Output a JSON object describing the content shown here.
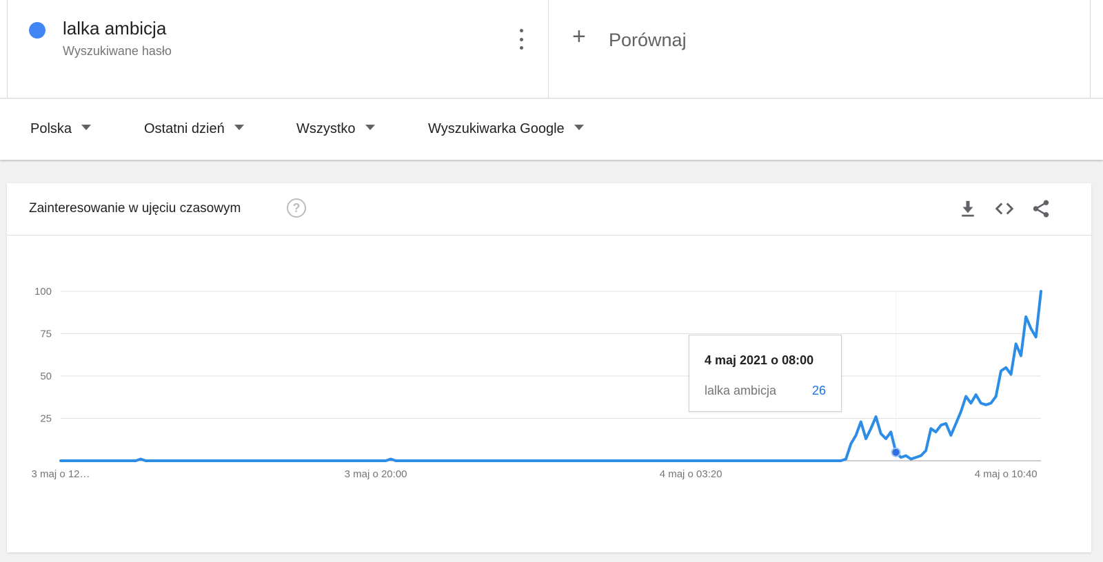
{
  "term": {
    "name": "lalka ambicja",
    "type": "Wyszukiwane hasło",
    "color": "#4285f4"
  },
  "compare": {
    "plus": "+",
    "label": "Porównaj"
  },
  "filters": [
    {
      "label": "Polska"
    },
    {
      "label": "Ostatni dzień"
    },
    {
      "label": "Wszystko"
    },
    {
      "label": "Wyszukiwarka Google"
    }
  ],
  "card": {
    "title": "Zainteresowanie w ujęciu czasowym",
    "help": "?",
    "icons": [
      "download-icon",
      "embed-code-icon",
      "share-icon"
    ]
  },
  "tooltip": {
    "date": "4 maj 2021 o 08:00",
    "term": "lalka ambicja",
    "value": "26"
  },
  "chart_data": {
    "type": "line",
    "series": [
      {
        "name": "lalka ambicja",
        "color": "#2d8de6",
        "values": [
          0,
          0,
          0,
          0,
          0,
          0,
          0,
          0,
          0,
          0,
          0,
          0,
          0,
          0,
          0,
          0,
          1,
          0,
          0,
          0,
          0,
          0,
          0,
          0,
          0,
          0,
          0,
          0,
          0,
          0,
          0,
          0,
          0,
          0,
          0,
          0,
          0,
          0,
          0,
          0,
          0,
          0,
          0,
          0,
          0,
          0,
          0,
          0,
          0,
          0,
          0,
          0,
          0,
          0,
          0,
          0,
          0,
          0,
          0,
          0,
          0,
          0,
          0,
          0,
          0,
          0,
          1,
          0,
          0,
          0,
          0,
          0,
          0,
          0,
          0,
          0,
          0,
          0,
          0,
          0,
          0,
          0,
          0,
          0,
          0,
          0,
          0,
          0,
          0,
          0,
          0,
          0,
          0,
          0,
          0,
          0,
          0,
          0,
          0,
          0,
          0,
          0,
          0,
          0,
          0,
          0,
          0,
          0,
          0,
          0,
          0,
          0,
          0,
          0,
          0,
          0,
          0,
          0,
          0,
          0,
          0,
          0,
          0,
          0,
          0,
          0,
          0,
          0,
          0,
          0,
          0,
          0,
          0,
          0,
          0,
          0,
          0,
          0,
          0,
          0,
          0,
          0,
          0,
          0,
          0,
          0,
          0,
          0,
          0,
          0,
          0,
          0,
          0,
          0,
          0,
          0,
          0,
          1,
          10,
          15,
          23,
          13,
          19,
          26,
          16,
          13,
          17,
          5,
          2,
          3,
          1,
          2,
          3,
          6,
          19,
          17,
          21,
          22,
          15,
          22,
          29,
          38,
          34,
          39,
          34,
          33,
          34,
          38,
          53,
          55,
          51,
          69,
          62,
          85,
          78,
          73,
          100
        ]
      }
    ],
    "y_ticks": [
      "100",
      "75",
      "50",
      "25"
    ],
    "x_tick_labels": [
      "3 maj o 12…",
      "3 maj o 20:00",
      "4 maj o 03:20",
      "4 maj o 10:40"
    ],
    "x_tick_indices": [
      0,
      63,
      126,
      189
    ],
    "ylim": [
      0,
      100
    ],
    "highlight_index": 167,
    "grid": true,
    "legend": "none"
  }
}
